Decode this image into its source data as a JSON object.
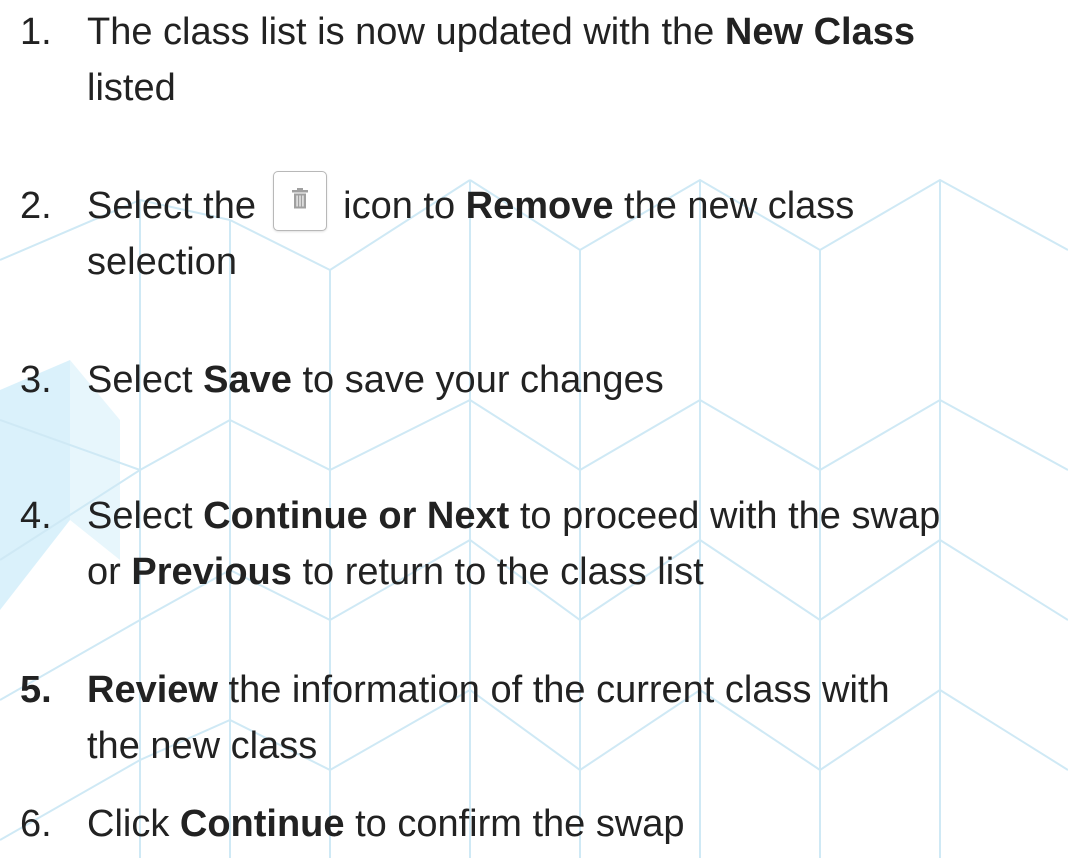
{
  "steps": [
    {
      "number": "1.",
      "number_bold": false,
      "lines": [
        [
          {
            "t": "The class list is now updated with the ",
            "b": false
          },
          {
            "t": "New Class",
            "b": true
          }
        ],
        [
          {
            "t": "listed",
            "b": false
          }
        ]
      ]
    },
    {
      "number": "2.",
      "number_bold": false,
      "lines": [
        [
          {
            "t": "Select the ",
            "b": false
          },
          {
            "icon": "trash-icon"
          },
          {
            "t": " icon to ",
            "b": false
          },
          {
            "t": "Remove",
            "b": true
          },
          {
            "t": " the new class",
            "b": false
          }
        ],
        [
          {
            "t": "selection",
            "b": false
          }
        ]
      ]
    },
    {
      "number": "3.",
      "number_bold": false,
      "lines": [
        [
          {
            "t": "Select ",
            "b": false
          },
          {
            "t": "Save",
            "b": true
          },
          {
            "t": " to save your changes",
            "b": false
          }
        ]
      ]
    },
    {
      "number": "4.",
      "number_bold": false,
      "lines": [
        [
          {
            "t": "Select ",
            "b": false
          },
          {
            "t": "Continue or Next",
            "b": true
          },
          {
            "t": " to proceed with the swap",
            "b": false
          }
        ],
        [
          {
            "t": "or ",
            "b": false
          },
          {
            "t": "Previous",
            "b": true
          },
          {
            "t": " to return to the class list",
            "b": false
          }
        ]
      ]
    },
    {
      "number": "5.",
      "number_bold": true,
      "lines": [
        [
          {
            "t": "Review",
            "b": true
          },
          {
            "t": " the information of the current class with",
            "b": false
          }
        ],
        [
          {
            "t": "the new class",
            "b": false
          }
        ]
      ]
    },
    {
      "number": "6.",
      "number_bold": false,
      "lines": [
        [
          {
            "t": "Click ",
            "b": false
          },
          {
            "t": "Continue",
            "b": true
          },
          {
            "t": " to confirm the swap",
            "b": false
          }
        ]
      ]
    }
  ],
  "colors": {
    "text": "#222222",
    "pattern_line": "#cfe9f5",
    "accent_shape": "#d4eefa",
    "icon_gray": "#a0a0a0"
  }
}
